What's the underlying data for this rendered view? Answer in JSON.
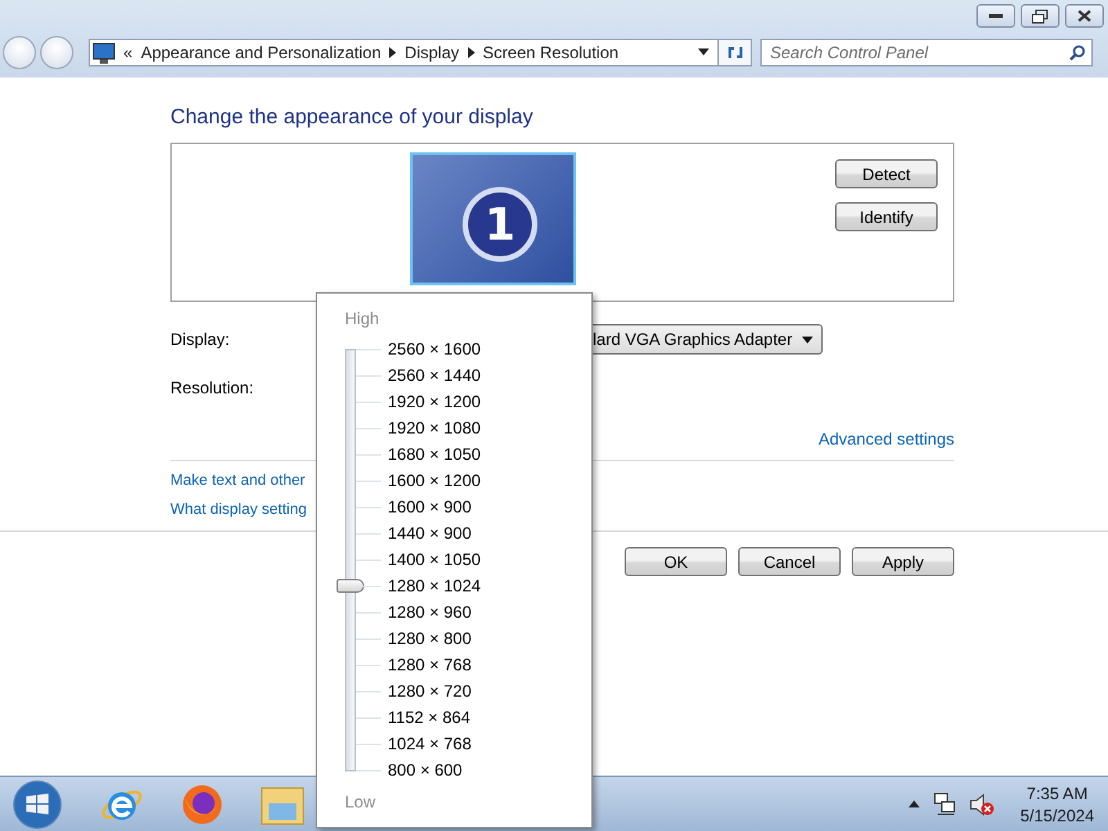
{
  "address_bar": {
    "overflow": "«",
    "breadcrumbs": [
      "Appearance and Personalization",
      "Display",
      "Screen Resolution"
    ]
  },
  "search": {
    "placeholder": "Search Control Panel"
  },
  "heading": "Change the appearance of your display",
  "monitor": {
    "number": "1",
    "selected": true
  },
  "side_buttons": [
    "Detect",
    "Identify"
  ],
  "fields": [
    {
      "label": "Display:",
      "value": "lard VGA Graphics Adapter"
    },
    {
      "label": "Resolution:"
    }
  ],
  "advanced_link": "Advanced settings",
  "links": [
    "Make text and other",
    "What display setting"
  ],
  "buttons": [
    "OK",
    "Cancel",
    "Apply"
  ],
  "resolution_popup": {
    "top_label": "High",
    "bottom_label": "Low",
    "level": 0.4375,
    "options": [
      "2560 × 1600",
      "2560 × 1440",
      "1920 × 1200",
      "1920 × 1080",
      "1680 × 1050",
      "1600 × 1200",
      "1600 × 900",
      "1440 × 900",
      "1400 × 1050",
      "1280 × 1024",
      "1280 × 960",
      "1280 × 800",
      "1280 × 768",
      "1280 × 720",
      "1152 × 864",
      "1024 × 768",
      "800 × 600"
    ]
  },
  "taskbar": {
    "time": "7:35 AM",
    "date": "5/15/2024"
  }
}
